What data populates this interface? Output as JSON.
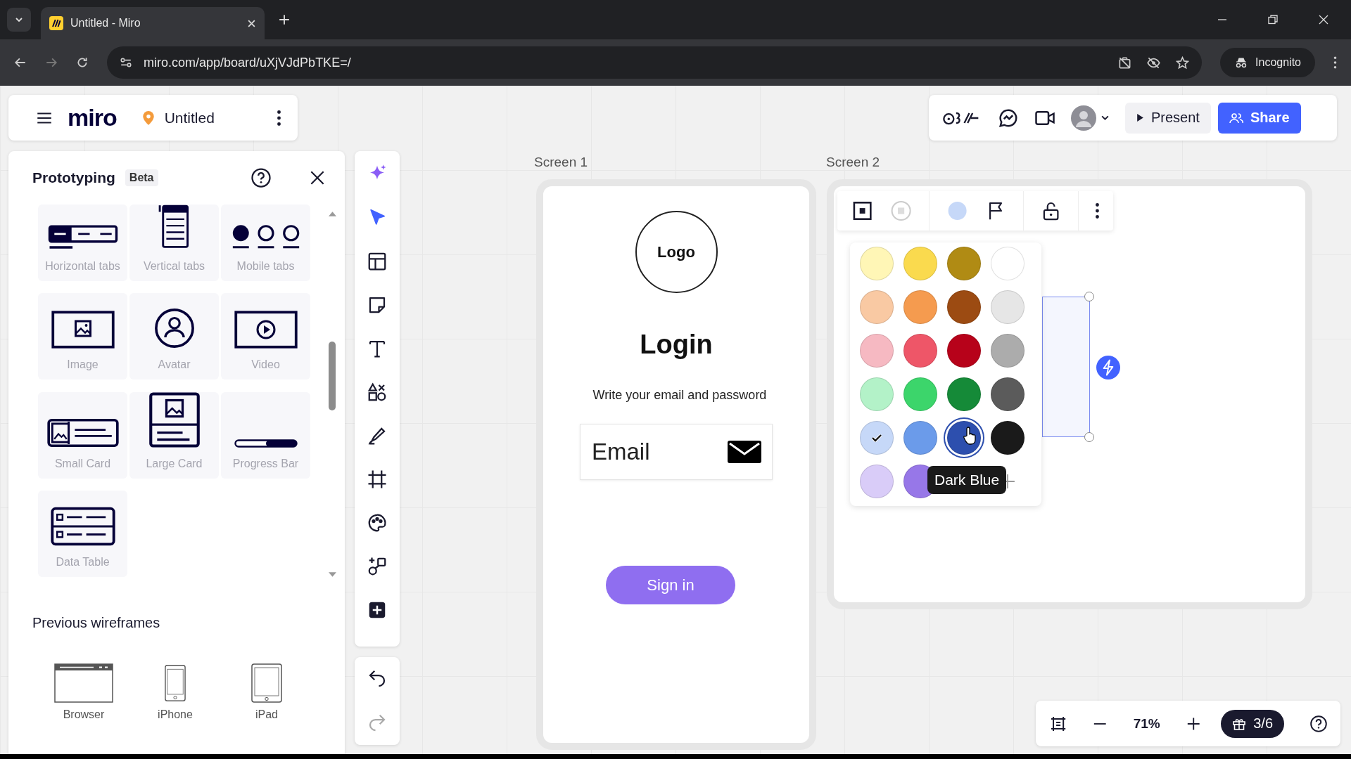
{
  "browser": {
    "tab_title": "Untitled - Miro",
    "url": "miro.com/app/board/uXjVJdPbTKE=/",
    "profile": "Incognito"
  },
  "board_header": {
    "logo": "miro",
    "board_name": "Untitled"
  },
  "top_toolbar": {
    "present": "Present",
    "share": "Share"
  },
  "prototyping_panel": {
    "title": "Prototyping",
    "badge": "Beta",
    "components": [
      {
        "label": "Horizontal tabs",
        "kind": "htabs"
      },
      {
        "label": "Vertical tabs",
        "kind": "vtabs"
      },
      {
        "label": "Mobile tabs",
        "kind": "mtabs"
      },
      {
        "label": "Image",
        "kind": "image"
      },
      {
        "label": "Avatar",
        "kind": "avatar"
      },
      {
        "label": "Video",
        "kind": "video"
      },
      {
        "label": "Small Card",
        "kind": "smallcard"
      },
      {
        "label": "Large Card",
        "kind": "largecard"
      },
      {
        "label": "Progress Bar",
        "kind": "progress"
      },
      {
        "label": "Data Table",
        "kind": "datatable"
      }
    ],
    "section_title": "Previous wireframes",
    "wireframes": [
      {
        "label": "Browser",
        "kind": "browser"
      },
      {
        "label": "iPhone",
        "kind": "phone"
      },
      {
        "label": "iPad",
        "kind": "tablet"
      }
    ]
  },
  "tools": [
    {
      "kind": "ai",
      "selected": false
    },
    {
      "kind": "select",
      "selected": true
    },
    {
      "kind": "template",
      "selected": false
    },
    {
      "kind": "sticky",
      "selected": false
    },
    {
      "kind": "text",
      "selected": false
    },
    {
      "kind": "shapes",
      "selected": false
    },
    {
      "kind": "pen",
      "selected": false
    },
    {
      "kind": "frame",
      "selected": false
    },
    {
      "kind": "palette",
      "selected": false
    },
    {
      "kind": "diagram",
      "selected": false
    },
    {
      "kind": "add",
      "selected": false
    }
  ],
  "screen_1": {
    "label": "Screen 1",
    "logo": "Logo",
    "heading": "Login",
    "subtitle": "Write your email and password",
    "email_field": {
      "placeholder": "Email"
    },
    "button": "Sign in"
  },
  "screen_2": {
    "label": "Screen 2"
  },
  "color_picker": {
    "tooltip": "Dark Blue",
    "swatches": [
      {
        "color": "#fff6b6",
        "selected": false,
        "hovered": false
      },
      {
        "color": "#fada4e",
        "selected": false,
        "hovered": false
      },
      {
        "color": "#b08b14",
        "selected": false,
        "hovered": false
      },
      {
        "color": "#ffffff",
        "selected": false,
        "hovered": false
      },
      {
        "color": "#f9c9a3",
        "selected": false,
        "hovered": false
      },
      {
        "color": "#f59b4f",
        "selected": false,
        "hovered": false
      },
      {
        "color": "#9c4b12",
        "selected": false,
        "hovered": false
      },
      {
        "color": "#e6e6e6",
        "selected": false,
        "hovered": false
      },
      {
        "color": "#f6b9c2",
        "selected": false,
        "hovered": false
      },
      {
        "color": "#ee5668",
        "selected": false,
        "hovered": false
      },
      {
        "color": "#b7021a",
        "selected": false,
        "hovered": false
      },
      {
        "color": "#acacac",
        "selected": false,
        "hovered": false
      },
      {
        "color": "#b3f2c8",
        "selected": false,
        "hovered": false
      },
      {
        "color": "#3cd56b",
        "selected": false,
        "hovered": false
      },
      {
        "color": "#158a38",
        "selected": false,
        "hovered": false
      },
      {
        "color": "#5b5b5b",
        "selected": false,
        "hovered": false
      },
      {
        "color": "#c6d8f8",
        "selected": true,
        "hovered": false
      },
      {
        "color": "#6b9bea",
        "selected": false,
        "hovered": false
      },
      {
        "color": "#2d4fae",
        "selected": false,
        "hovered": true
      },
      {
        "color": "#1a1a1a",
        "selected": false,
        "hovered": false
      },
      {
        "color": "#d9ccf8",
        "selected": false,
        "hovered": false
      },
      {
        "color": "#9777e8",
        "selected": false,
        "hovered": false
      }
    ]
  },
  "zoom_bar": {
    "zoom": "71%",
    "gifts": "3/6"
  }
}
